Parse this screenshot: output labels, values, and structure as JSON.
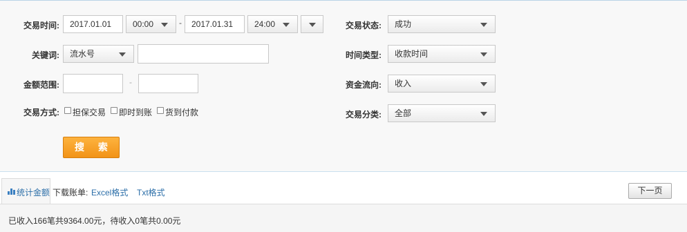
{
  "form": {
    "trade_time": {
      "label": "交易时间:",
      "start_date": "2017.01.01",
      "start_time": "00:00",
      "separator": "-",
      "end_date": "2017.01.31",
      "end_time": "24:00"
    },
    "keyword": {
      "label": "关键词:",
      "type_selected": "流水号",
      "value": ""
    },
    "amount_range": {
      "label": "金额范围:",
      "min": "",
      "separator": "-",
      "max": ""
    },
    "trade_method": {
      "label": "交易方式:",
      "options": [
        "担保交易",
        "即时到账",
        "货到付款"
      ]
    },
    "trade_status": {
      "label": "交易状态:",
      "selected": "成功"
    },
    "time_type": {
      "label": "时间类型:",
      "selected": "收款时间"
    },
    "fund_flow": {
      "label": "资金流向:",
      "selected": "收入"
    },
    "trade_category": {
      "label": "交易分类:",
      "selected": "全部"
    },
    "search_button": "搜 索"
  },
  "toolbar": {
    "stats_tab": "统计金额",
    "download_label": "下载账单:",
    "excel_link": "Excel格式",
    "txt_link": "Txt格式",
    "next_page": "下一页"
  },
  "summary": "已收入166笔共9364.00元，待收入0笔共0.00元",
  "colors": {
    "accent_orange": "#f7a12a",
    "link_blue": "#2b6ea8",
    "panel_bg": "#f8f8f8"
  },
  "icons": {
    "dropdown": "caret-down-icon",
    "stats": "bar-chart-icon"
  }
}
